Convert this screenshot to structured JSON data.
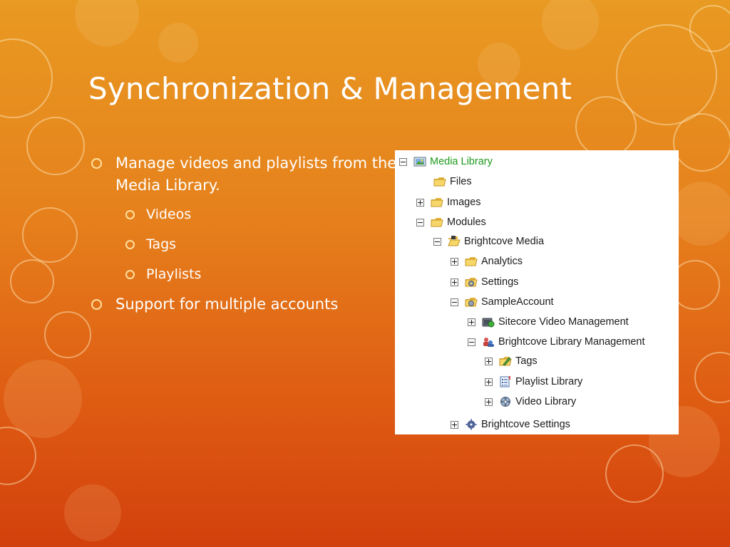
{
  "slide": {
    "title": "Synchronization & Management",
    "bullets": [
      "Manage videos and playlists from the Media Library.",
      "Videos",
      "Tags",
      "Playlists",
      "Support for multiple accounts"
    ]
  },
  "tree": {
    "nodes": [
      {
        "label": "Media Library",
        "icon": "media-library-icon",
        "expander": "minus"
      },
      {
        "label": "Files",
        "icon": "folder-icon",
        "expander": "none"
      },
      {
        "label": "Images",
        "icon": "folder-icon",
        "expander": "plus"
      },
      {
        "label": "Modules",
        "icon": "folder-icon",
        "expander": "minus"
      },
      {
        "label": "Brightcove Media",
        "icon": "open-folder-icon",
        "expander": "minus"
      },
      {
        "label": "Analytics",
        "icon": "folder-icon",
        "expander": "plus"
      },
      {
        "label": "Settings",
        "icon": "settings-folder-icon",
        "expander": "plus"
      },
      {
        "label": "SampleAccount",
        "icon": "account-folder-icon",
        "expander": "minus"
      },
      {
        "label": "Sitecore Video Management",
        "icon": "video-management-icon",
        "expander": "plus"
      },
      {
        "label": "Brightcove Library Management",
        "icon": "library-management-icon",
        "expander": "minus"
      },
      {
        "label": "Tags",
        "icon": "tag-folder-icon",
        "expander": "plus"
      },
      {
        "label": "Playlist Library",
        "icon": "playlist-icon",
        "expander": "plus"
      },
      {
        "label": "Video Library",
        "icon": "video-library-icon",
        "expander": "plus"
      },
      {
        "label": "Brightcove Settings",
        "icon": "gear-icon",
        "expander": "plus"
      }
    ]
  },
  "colors": {
    "background_top": "#e89a22",
    "background_bottom": "#d2400c",
    "bullet_marker": "#ffe1a0",
    "tree_root_label": "#1e9a1e"
  }
}
